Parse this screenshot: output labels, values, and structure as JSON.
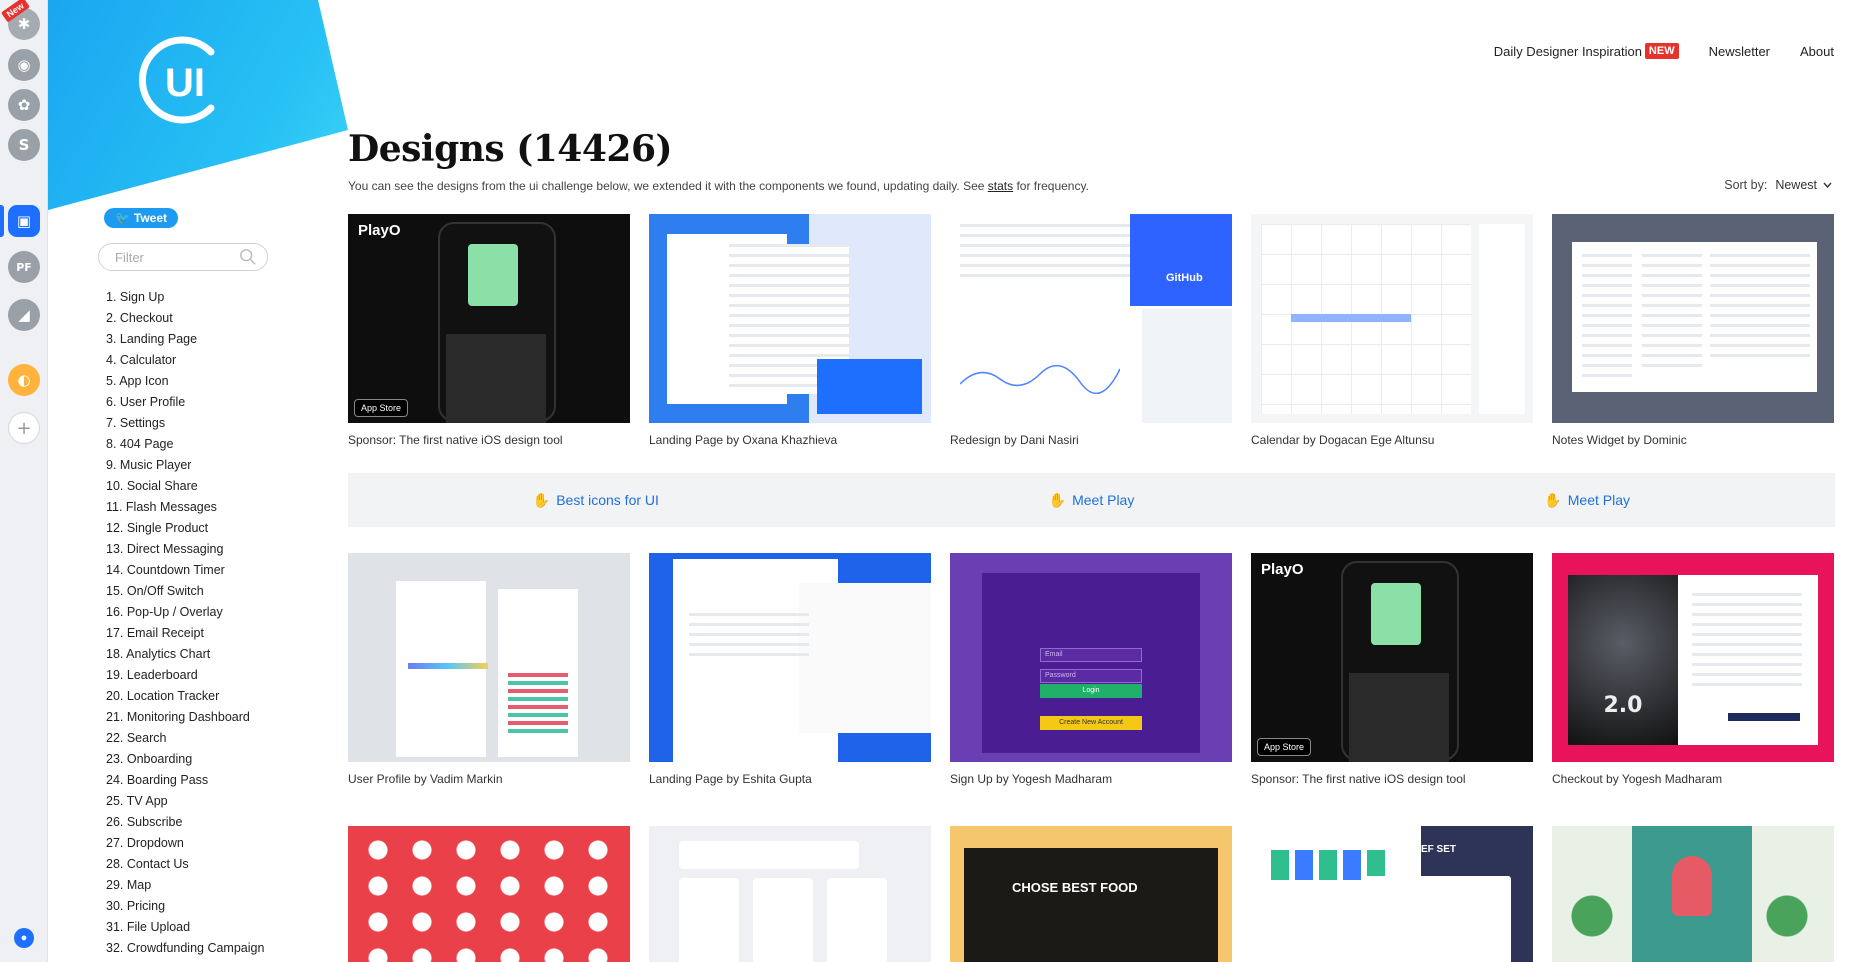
{
  "dock": {
    "new_badge": "New",
    "items": [
      "flash-icon",
      "shield-icon",
      "palette-icon",
      "s-app-icon",
      "uidesigndaily-icon",
      "pf-icon",
      "chart-icon",
      "bread-icon",
      "add-icon"
    ]
  },
  "brand": {
    "logo_text": "UI"
  },
  "sidebar": {
    "tweet_label": "Tweet",
    "filter_placeholder": "Filter",
    "challenges": [
      "1. Sign Up",
      "2. Checkout",
      "3. Landing Page",
      "4. Calculator",
      "5. App Icon",
      "6. User Profile",
      "7. Settings",
      "8. 404 Page",
      "9. Music Player",
      "10. Social Share",
      "11. Flash Messages",
      "12. Single Product",
      "13. Direct Messaging",
      "14. Countdown Timer",
      "15. On/Off Switch",
      "16. Pop-Up / Overlay",
      "17. Email Receipt",
      "18. Analytics Chart",
      "19. Leaderboard",
      "20. Location Tracker",
      "21. Monitoring Dashboard",
      "22. Search",
      "23. Onboarding",
      "24. Boarding Pass",
      "25. TV App",
      "26. Subscribe",
      "27. Dropdown",
      "28. Contact Us",
      "29. Map",
      "30. Pricing",
      "31. File Upload",
      "32. Crowdfunding Campaign"
    ]
  },
  "nav": {
    "inspiration": "Daily Designer Inspiration",
    "new_badge": "NEW",
    "newsletter": "Newsletter",
    "about": "About"
  },
  "main": {
    "title": "Designs (14426)",
    "subtitle_pre": "You can see the designs from the ui challenge below, we extended it with the components we found, updating daily. See ",
    "subtitle_link": "stats",
    "subtitle_post": " for frequency.",
    "sort_label": "Sort by:",
    "sort_value": "Newest"
  },
  "row1": [
    "Sponsor: The first native iOS design tool",
    "Landing Page by Oxana Khazhieva",
    "Redesign by Dani Nasiri",
    "Calendar by Dogacan Ege Altunsu",
    "Notes Widget by Dominic"
  ],
  "promo": [
    "Best icons for UI",
    "Meet Play",
    "Meet Play"
  ],
  "row2": [
    "User Profile by Vadim Markin",
    "Landing Page by Eshita Gupta",
    "Sign Up by Yogesh Madharam",
    "Sponsor: The first native iOS design tool",
    "Checkout by Yogesh Madharam"
  ],
  "thumbs": {
    "playo": "PlayO",
    "appstore": "App Store",
    "github": "GitHub",
    "login_email": "Email",
    "login_password": "Password",
    "login_btn": "Login",
    "create_btn": "Create New Account",
    "movie": "2.0",
    "food": "CHOSE BEST FOOD",
    "ef_set": "EF SET"
  },
  "colors": {
    "accent": "#1f6fff",
    "brand": "#1aa6f0",
    "badge_red": "#e5322d",
    "link": "#1f6fdd"
  }
}
